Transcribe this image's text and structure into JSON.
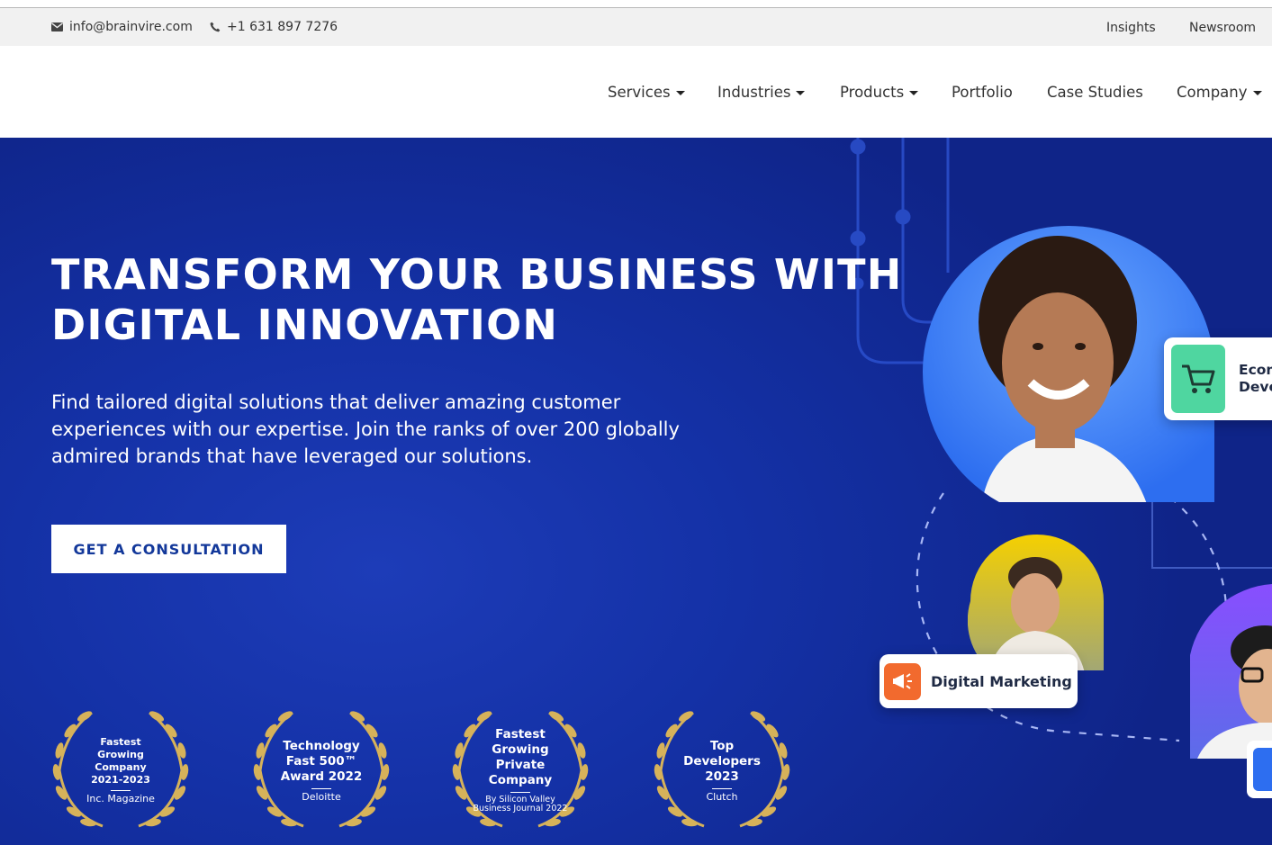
{
  "topbar": {
    "email": "info@brainvire.com",
    "phone": "+1 631 897 7276",
    "links": [
      "Insights",
      "Newsroom"
    ]
  },
  "nav": {
    "items": [
      {
        "label": "Services",
        "dropdown": true
      },
      {
        "label": "Industries",
        "dropdown": true
      },
      {
        "label": "Products",
        "dropdown": true
      },
      {
        "label": "Portfolio",
        "dropdown": false
      },
      {
        "label": "Case Studies",
        "dropdown": false
      },
      {
        "label": "Company",
        "dropdown": true
      }
    ]
  },
  "hero": {
    "title_line1": "TRANSFORM YOUR BUSINESS WITH",
    "title_line2": "DIGITAL INNOVATION",
    "description": "Find tailored digital solutions that deliver amazing customer experiences with our expertise. Join the ranks of over 200 globally admired brands that have leveraged our solutions.",
    "cta_label": "GET A CONSULTATION"
  },
  "awards": [
    {
      "lines": [
        "Fastest",
        "Growing Company",
        "2021-2023"
      ],
      "source": "Inc. Magazine"
    },
    {
      "lines": [
        "Technology",
        "Fast 500™",
        "Award 2022"
      ],
      "source": "Deloitte"
    },
    {
      "lines": [
        "Fastest",
        "Growing Private",
        "Company"
      ],
      "source": "By Silicon Valley Business Journal 2022"
    },
    {
      "lines": [
        "Top",
        "Developers",
        "2023"
      ],
      "source": "Clutch"
    }
  ],
  "illustration": {
    "chip_ecommerce": "Ecom\nDeve",
    "chip_marketing": "Digital Marketing"
  },
  "colors": {
    "hero_bg": "#1431a6",
    "cta_text": "#13389a",
    "laurel_gold": "#d6b25a",
    "cart_chip": "#4fd6a0",
    "marketing_chip": "#f26a2e",
    "avatar_ring_top": "#3b82f6",
    "avatar_ring_middle": "#f5c400",
    "avatar_ring_bottom": "#7c3aed"
  },
  "icons": [
    "mail-icon",
    "phone-icon",
    "shopping-cart-icon",
    "megaphone-icon"
  ]
}
